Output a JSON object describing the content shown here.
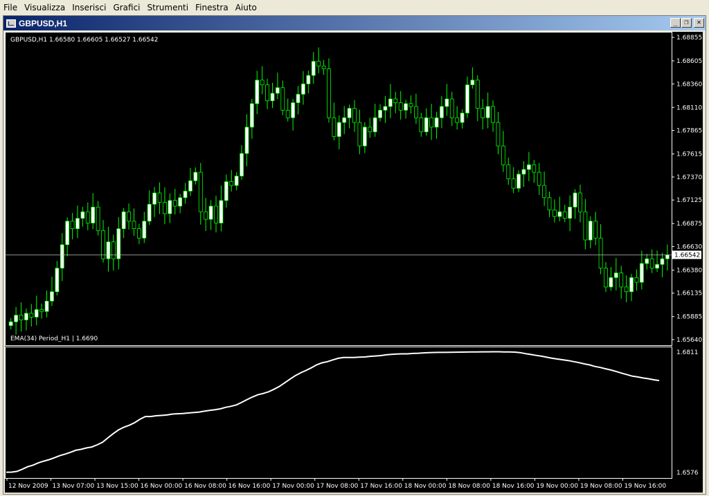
{
  "menu": [
    "File",
    "Visualizza",
    "Inserisci",
    "Grafici",
    "Strumenti",
    "Finestra",
    "Aiuto"
  ],
  "window": {
    "title": "GBPUSD,H1",
    "buttons": {
      "minimize": "_",
      "restore": "❐",
      "close": "✕"
    }
  },
  "main_chart": {
    "info": "GBPUSD,H1  1.66580 1.66605 1.66527 1.66542",
    "current_price": "1.66542",
    "price_ticks": [
      "1.68855",
      "1.68605",
      "1.68360",
      "1.68110",
      "1.67865",
      "1.67615",
      "1.67370",
      "1.67125",
      "1.66875",
      "1.66630",
      "1.66380",
      "1.66135",
      "1.65885",
      "1.65640"
    ]
  },
  "indicator": {
    "info": "EMA(34) Period_H1 | 1.6690",
    "top_label": "1.6811",
    "bottom_label": "1.6576"
  },
  "time_ticks": [
    "12 Nov 2009",
    "13 Nov 07:00",
    "13 Nov 15:00",
    "16 Nov 00:00",
    "16 Nov 08:00",
    "16 Nov 16:00",
    "17 Nov 00:00",
    "17 Nov 08:00",
    "17 Nov 16:00",
    "18 Nov 00:00",
    "18 Nov 08:00",
    "18 Nov 16:00",
    "19 Nov 00:00",
    "19 Nov 08:00",
    "19 Nov 16:00"
  ],
  "colors": {
    "background": "#000000",
    "bull": "#ffffff",
    "bear": "#000000",
    "wick": "#00ff00",
    "ema": "#ffffff",
    "axis": "#ffffff",
    "price_line": "#c0c0c0"
  },
  "chart_data": {
    "type": "candlestick",
    "symbol": "GBPUSD",
    "timeframe": "H1",
    "ylim": [
      1.6564,
      1.68855
    ],
    "closes": [
      1.6583,
      1.659,
      1.6585,
      1.6592,
      1.6588,
      1.6596,
      1.6594,
      1.6605,
      1.6615,
      1.664,
      1.6665,
      1.669,
      1.6682,
      1.6693,
      1.67,
      1.6688,
      1.6705,
      1.668,
      1.665,
      1.6668,
      1.665,
      1.6682,
      1.67,
      1.669,
      1.6682,
      1.6672,
      1.669,
      1.6708,
      1.672,
      1.671,
      1.6698,
      1.6712,
      1.6706,
      1.6715,
      1.6722,
      1.6733,
      1.6742,
      1.67,
      1.6692,
      1.6706,
      1.6688,
      1.6712,
      1.6732,
      1.6728,
      1.6738,
      1.6762,
      1.679,
      1.6815,
      1.684,
      1.6835,
      1.6818,
      1.6826,
      1.6832,
      1.6808,
      1.68,
      1.6816,
      1.6825,
      1.6836,
      1.6845,
      1.686,
      1.6855,
      1.6852,
      1.68,
      1.678,
      1.6795,
      1.68,
      1.681,
      1.6795,
      1.677,
      1.679,
      1.6785,
      1.68,
      1.6808,
      1.6812,
      1.682,
      1.6816,
      1.6808,
      1.6815,
      1.6812,
      1.68,
      1.6785,
      1.68,
      1.679,
      1.68,
      1.6812,
      1.682,
      1.68,
      1.6795,
      1.6805,
      1.6835,
      1.684,
      1.681,
      1.68,
      1.6812,
      1.6795,
      1.677,
      1.675,
      1.6735,
      1.6725,
      1.674,
      1.6745,
      1.675,
      1.6742,
      1.6728,
      1.6715,
      1.6702,
      1.6695,
      1.67,
      1.6693,
      1.6705,
      1.672,
      1.67,
      1.667,
      1.669,
      1.6672,
      1.664,
      1.662,
      1.663,
      1.6635,
      1.662,
      1.6615,
      1.663,
      1.6625,
      1.6645,
      1.665,
      1.664,
      1.6644,
      1.665,
      1.6654
    ],
    "ema": [
      1.65765,
      1.65767,
      1.65782,
      1.65823,
      1.65872,
      1.65903,
      1.65948,
      1.65981,
      1.6601,
      1.66048,
      1.66088,
      1.66119,
      1.66154,
      1.66193,
      1.66213,
      1.66239,
      1.66258,
      1.663,
      1.6635,
      1.66437,
      1.66519,
      1.66592,
      1.66645,
      1.66683,
      1.66732,
      1.668,
      1.66853,
      1.66853,
      1.66868,
      1.66874,
      1.66882,
      1.669,
      1.66906,
      1.66911,
      1.66922,
      1.66929,
      1.66939,
      1.66957,
      1.66973,
      1.66986,
      1.67002,
      1.67032,
      1.67052,
      1.67079,
      1.67129,
      1.67184,
      1.67234,
      1.67277,
      1.67303,
      1.67335,
      1.67384,
      1.67438,
      1.67507,
      1.6758,
      1.67649,
      1.67705,
      1.67752,
      1.67804,
      1.67862,
      1.679,
      1.67924,
      1.67958,
      1.67988,
      1.68004,
      1.68004,
      1.68004,
      1.68011,
      1.68015,
      1.68027,
      1.68034,
      1.68042,
      1.68057,
      1.68065,
      1.68072,
      1.68076,
      1.68076,
      1.68084,
      1.68088,
      1.68095,
      1.68099,
      1.68103,
      1.68105,
      1.68105,
      1.68107,
      1.68109,
      1.6811,
      1.68112,
      1.68113,
      1.68114,
      1.68115,
      1.68116,
      1.68117,
      1.68117,
      1.68114,
      1.68114,
      1.6811,
      1.681,
      1.6808,
      1.68064,
      1.68046,
      1.6803,
      1.6801,
      1.6799,
      1.67975,
      1.6796,
      1.67945,
      1.67925,
      1.67905,
      1.6788,
      1.6786,
      1.6783,
      1.6781,
      1.67785,
      1.6776,
      1.6773,
      1.677,
      1.6767,
      1.6764,
      1.67625,
      1.67605,
      1.6759,
      1.6757,
      1.67555
    ],
    "ema_ylim": [
      1.6576,
      1.6811
    ],
    "ema_last": 1.669,
    "last_close": 1.66542
  }
}
